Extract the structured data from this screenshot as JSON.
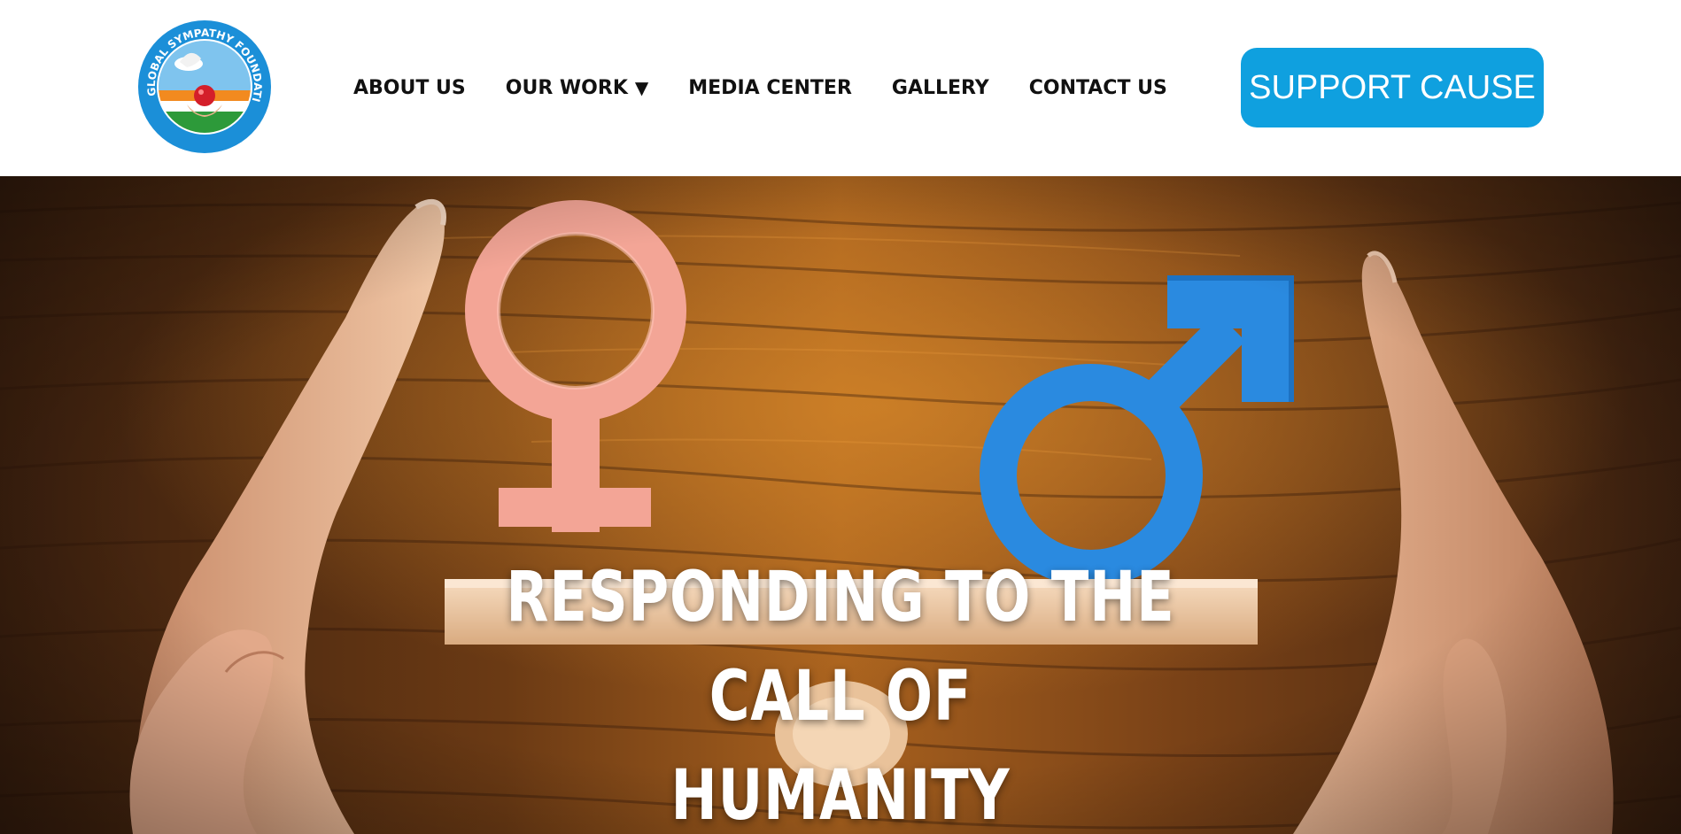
{
  "header": {
    "logo": {
      "alt_text": "GLOBAL SYMPATHY FOUNDATION (R.)",
      "icon": "dove-heart-hands-logo"
    },
    "nav": [
      {
        "label": "ABOUT US",
        "has_dropdown": false
      },
      {
        "label": "OUR WORK",
        "has_dropdown": true,
        "caret": "▼"
      },
      {
        "label": "MEDIA CENTER",
        "has_dropdown": false
      },
      {
        "label": "GALLERY",
        "has_dropdown": false
      },
      {
        "label": "CONTACT US",
        "has_dropdown": false
      }
    ],
    "cta_label": "SUPPORT CAUSE"
  },
  "hero": {
    "headline_line1": "RESPONDING TO THE CALL OF",
    "headline_line2": "HUMANITY",
    "image_icons": [
      "female-symbol-icon",
      "male-symbol-icon",
      "hand-icon",
      "seesaw-icon"
    ]
  },
  "colors": {
    "accent": "#0fa0df",
    "nav_text": "#111111",
    "wood": "#6b3a14",
    "female_symbol": "#f4a092",
    "male_symbol": "#2a8ae0"
  }
}
